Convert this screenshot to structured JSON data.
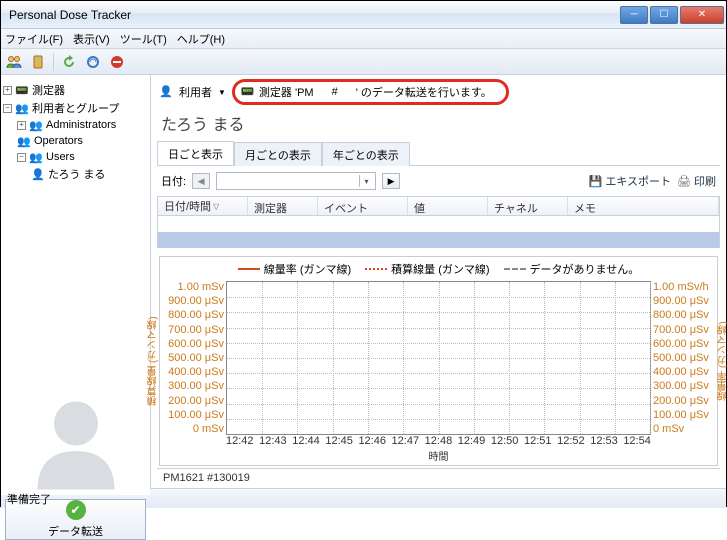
{
  "window": {
    "title": "Personal Dose Tracker"
  },
  "menu": {
    "file": "ファイル(F)",
    "view": "表示(V)",
    "tool": "ツール(T)",
    "help": "ヘルプ(H)"
  },
  "tree": {
    "instruments": "測定器",
    "users_groups": "利用者とグループ",
    "admins": "Administrators",
    "operators": "Operators",
    "users": "Users",
    "user1": "たろう まる"
  },
  "transfer_btn": "データ転送",
  "userbar": {
    "label": "利用者",
    "msg_prefix": "測定器 'PM",
    "msg_mid": "#",
    "msg_suffix": "' のデータ転送を行います。"
  },
  "username": "たろう まる",
  "tabs": {
    "day": "日ごと表示",
    "month": "月ごとの表示",
    "year": "年ごとの表示"
  },
  "date_label": "日付:",
  "export_label": "エキスポート",
  "print_label": "印刷",
  "grid": {
    "c1": "日付/時間",
    "c2": "測定器",
    "c3": "イベント",
    "c4": "値",
    "c5": "チャネル",
    "c6": "メモ"
  },
  "chart_data": {
    "type": "line",
    "series": [
      {
        "name": "線量率 (ガンマ線)",
        "style": "solid",
        "color": "#d04a1f",
        "values": []
      },
      {
        "name": "積算線量 (ガンマ線)",
        "style": "dot-red",
        "color": "#d04a1f",
        "values": []
      },
      {
        "name": "データがありません。",
        "style": "dash-gray",
        "color": "#888",
        "values": []
      }
    ],
    "x": [
      "12:42",
      "12:43",
      "12:44",
      "12:45",
      "12:46",
      "12:47",
      "12:48",
      "12:49",
      "12:50",
      "12:51",
      "12:52",
      "12:53",
      "12:54"
    ],
    "xlabel": "時間",
    "left_axis": {
      "label": "積算線量 (ガンマ線)",
      "ticks": [
        "1.00 mSv",
        "900.00 μSv",
        "800.00 μSv",
        "700.00 μSv",
        "600.00 μSv",
        "500.00 μSv",
        "400.00 μSv",
        "300.00 μSv",
        "200.00 μSv",
        "100.00 μSv",
        "0 mSv"
      ]
    },
    "right_axis": {
      "label": "線量率 (ガンマ線)",
      "ticks": [
        "1.00 mSv/h",
        "900.00 μSv",
        "800.00 μSv",
        "700.00 μSv",
        "600.00 μSv",
        "500.00 μSv",
        "400.00 μSv",
        "300.00 μSv",
        "200.00 μSv",
        "100.00 μSv",
        "0 mSv"
      ]
    }
  },
  "device": "PM1621 #130019",
  "status": "準備完了"
}
